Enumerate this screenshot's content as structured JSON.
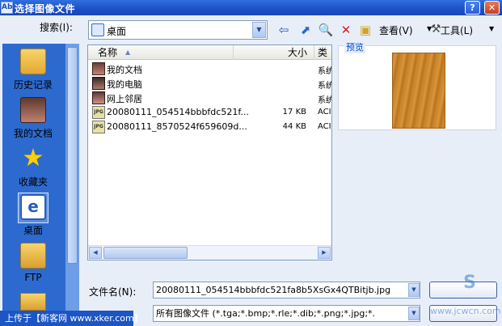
{
  "window": {
    "title": "选择图像文件",
    "icon_text": "Ab"
  },
  "toolbar": {
    "lookin_label": "搜索(I):",
    "lookin_value": "桌面",
    "view_label": "查看(V)",
    "tools_label": "工具(L)"
  },
  "places": [
    {
      "label": "历史记录",
      "icon": "history-folder-icon"
    },
    {
      "label": "我的文档",
      "icon": "my-documents-icon"
    },
    {
      "label": "收藏夹",
      "icon": "favorites-star-icon"
    },
    {
      "label": "桌面",
      "icon": "desktop-icon"
    },
    {
      "label": "FTP",
      "icon": "ftp-folder-icon"
    }
  ],
  "filelist": {
    "columns": {
      "name": "名称",
      "size": "大小",
      "type": "类"
    },
    "rows": [
      {
        "name": "我的文档",
        "size": "",
        "type": "系统",
        "icon": "my-documents-icon"
      },
      {
        "name": "我的电脑",
        "size": "",
        "type": "系统",
        "icon": "my-computer-icon"
      },
      {
        "name": "网上邻居",
        "size": "",
        "type": "系统",
        "icon": "network-icon"
      },
      {
        "name": "20080111_054514bbbfdc521f...",
        "size": "17 KB",
        "type": "ACI",
        "icon": "jpg-file-icon"
      },
      {
        "name": "20080111_8570524f659609d...",
        "size": "44 KB",
        "type": "ACI",
        "icon": "jpg-file-icon"
      }
    ]
  },
  "preview": {
    "label": "预览"
  },
  "bottom": {
    "filename_label": "文件名(N):",
    "filename_value": "20080111_054514bbbfdc521fa8b5XsGx4QTBitjb.jpg",
    "filetype_value": "所有图像文件 (*.tga;*.bmp;*.rle;*.dib;*.png;*.jpg;*."
  },
  "watermark": {
    "bar_text": "上传于【新客网 www.xker.com】",
    "site_text": "www.jcwcn.com",
    "logo_text": "S"
  }
}
